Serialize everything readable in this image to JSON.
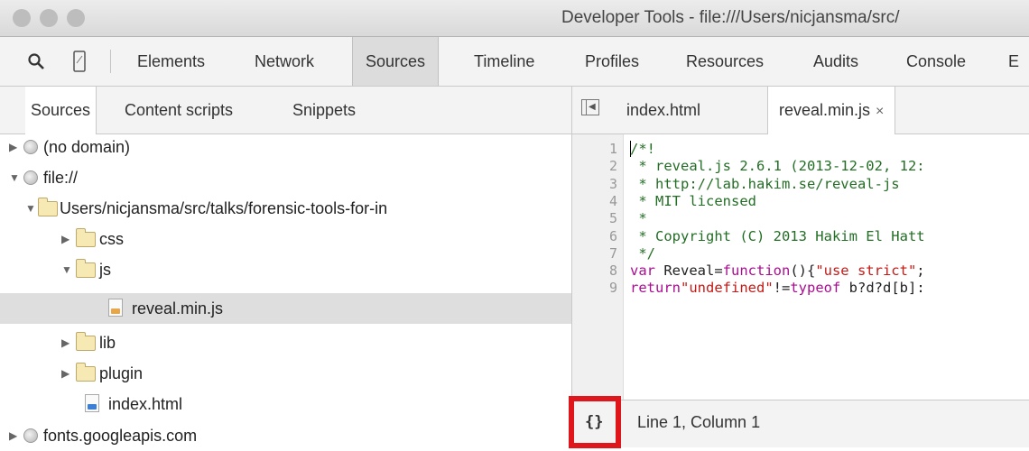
{
  "window": {
    "title": "Developer Tools - file:///Users/nicjansma/src/"
  },
  "toolbar": {
    "icons": [
      "search-icon",
      "device-mode-icon"
    ],
    "tabs": [
      "Elements",
      "Network",
      "Sources",
      "Timeline",
      "Profiles",
      "Resources",
      "Audits",
      "Console",
      "E"
    ],
    "active_tab": "Sources"
  },
  "sidebar": {
    "tabs": [
      "Sources",
      "Content scripts",
      "Snippets"
    ],
    "active_tab": "Sources",
    "tree": [
      {
        "label": "(no domain)",
        "type": "domain",
        "expanded": false
      },
      {
        "label": "file://",
        "type": "domain",
        "expanded": true
      },
      {
        "label": "Users/nicjansma/src/talks/forensic-tools-for-in",
        "type": "folder",
        "expanded": true
      },
      {
        "label": "css",
        "type": "folder",
        "expanded": false
      },
      {
        "label": "js",
        "type": "folder",
        "expanded": true
      },
      {
        "label": "reveal.min.js",
        "type": "js-file",
        "selected": true
      },
      {
        "label": "lib",
        "type": "folder",
        "expanded": false
      },
      {
        "label": "plugin",
        "type": "folder",
        "expanded": false
      },
      {
        "label": "index.html",
        "type": "html-file"
      },
      {
        "label": "fonts.googleapis.com",
        "type": "domain",
        "expanded": false
      }
    ]
  },
  "editor": {
    "tabs": [
      {
        "label": "index.html",
        "active": false
      },
      {
        "label": "reveal.min.js",
        "active": true,
        "close": "×"
      }
    ],
    "lines": [
      {
        "n": "1",
        "parts": [
          {
            "t": "/*!",
            "c": "comment"
          }
        ]
      },
      {
        "n": "2",
        "parts": [
          {
            "t": " * reveal.js 2.6.1 (2013-12-02, 12:",
            "c": "comment"
          }
        ]
      },
      {
        "n": "3",
        "parts": [
          {
            "t": " * http://lab.hakim.se/reveal-js",
            "c": "comment"
          }
        ]
      },
      {
        "n": "4",
        "parts": [
          {
            "t": " * MIT licensed",
            "c": "comment"
          }
        ]
      },
      {
        "n": "5",
        "parts": [
          {
            "t": " *",
            "c": "comment"
          }
        ]
      },
      {
        "n": "6",
        "parts": [
          {
            "t": " * Copyright (C) 2013 Hakim El Hatt",
            "c": "comment"
          }
        ]
      },
      {
        "n": "7",
        "parts": [
          {
            "t": " */",
            "c": "comment"
          }
        ]
      },
      {
        "n": "8",
        "parts": [
          {
            "t": "var",
            "c": "kw"
          },
          {
            "t": " Reveal=",
            "c": "plain"
          },
          {
            "t": "function",
            "c": "kw"
          },
          {
            "t": "(){",
            "c": "plain"
          },
          {
            "t": "\"use strict\"",
            "c": "str"
          },
          {
            "t": ";",
            "c": "plain"
          }
        ]
      },
      {
        "n": "9",
        "parts": [
          {
            "t": "return",
            "c": "kw"
          },
          {
            "t": "\"undefined\"",
            "c": "str"
          },
          {
            "t": "!=",
            "c": "plain"
          },
          {
            "t": "typeof",
            "c": "kw"
          },
          {
            "t": " b?d?d[b]:",
            "c": "plain"
          }
        ]
      }
    ],
    "status": {
      "pretty_print_label": "{}",
      "position": "Line 1, Column 1"
    }
  },
  "colors": {
    "comment": "#236e25",
    "keyword": "#aa0d91",
    "string": "#c41a16",
    "highlight": "#e0161d"
  }
}
